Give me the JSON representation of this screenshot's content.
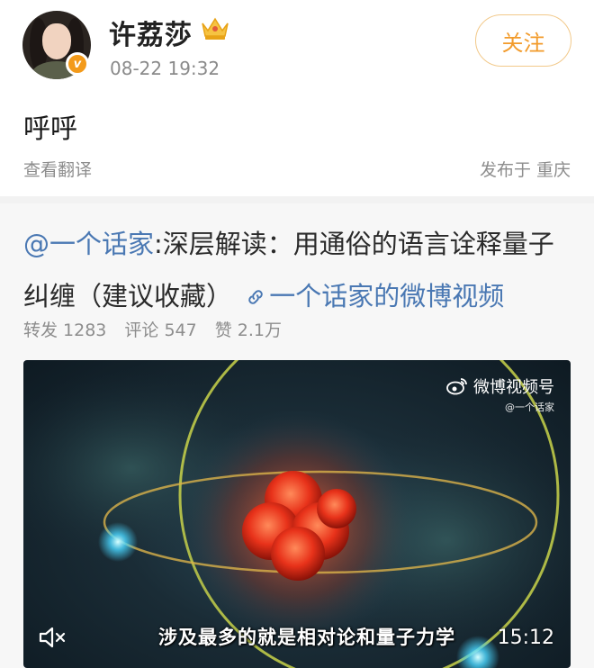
{
  "post": {
    "username": "许荔莎",
    "timestamp": "08-22 19:32",
    "follow_label": "关注",
    "content": "呼呼",
    "translate_label": "查看翻译",
    "location": "发布于 重庆",
    "verified_badge": "v"
  },
  "repost": {
    "mention": "@一个话家",
    "title": ":深层解读：用通俗的语言诠释量子纠缠（建议收藏）",
    "video_link": "一个话家的微博视频",
    "stats": {
      "repost": "转发 1283",
      "comment": "评论 547",
      "like": "赞 2.1万"
    }
  },
  "video": {
    "watermark_title": "微博视频号",
    "watermark_sub": "@一个话家",
    "subtitle": "涉及最多的就是相对论和量子力学",
    "duration": "15:12"
  },
  "icons": {
    "avatar": "avatar-image",
    "crown": "crown-icon",
    "link": "link-icon",
    "mute": "mute-icon",
    "weibo": "weibo-logo-icon"
  },
  "colors": {
    "accent": "#f29b2b",
    "link": "#4a78b3",
    "muted_text": "#8d8d8d"
  }
}
